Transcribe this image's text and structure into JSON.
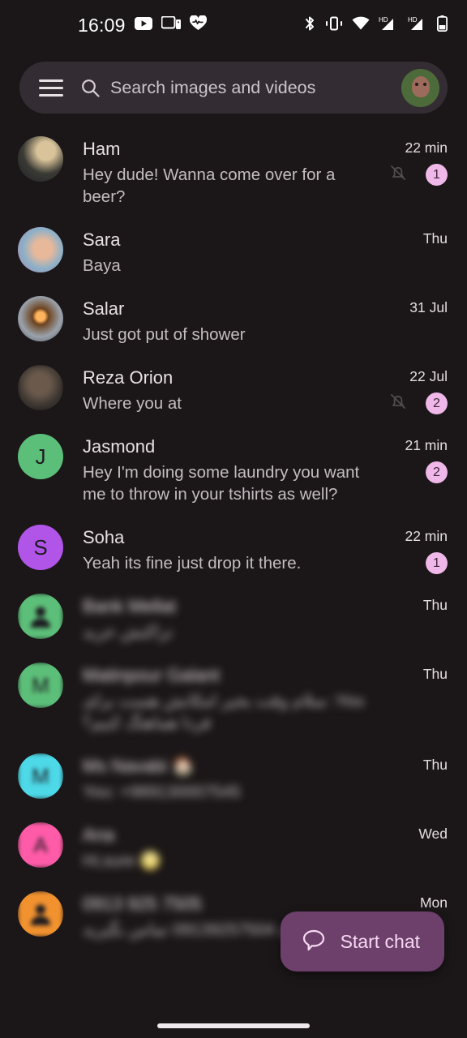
{
  "statusbar": {
    "time": "16:09",
    "left_icons": [
      "youtube-icon",
      "cast-icon",
      "heart-health-icon"
    ],
    "right_icons": [
      "bluetooth-icon",
      "vibrate-icon",
      "wifi-icon",
      "signal-hd-1-icon",
      "signal-hd-2-icon",
      "battery-icon"
    ]
  },
  "search": {
    "placeholder": "Search images and videos",
    "menu_icon": "hamburger-menu-icon",
    "search_icon": "search-icon",
    "avatar": "monkey-profile-avatar"
  },
  "colors": {
    "background": "#1b1718",
    "searchbar": "#332d33",
    "badge": "#efb8e8",
    "fab": "#6d3f6b",
    "fab_text": "#f6d9f2",
    "avatar_green": "#5cbf79",
    "avatar_purple": "#b055e8",
    "avatar_cyan": "#4dd9e8",
    "avatar_pink": "#ff5ba8",
    "avatar_orange": "#f2922f"
  },
  "fab": {
    "label": "Start chat",
    "icon": "chat-bubble-icon"
  },
  "conversations": [
    {
      "name": "Ham",
      "preview": "Hey dude! Wanna come over for a beer?",
      "time": "22 min",
      "badge": "1",
      "muted": true,
      "avatar_type": "photo",
      "avatar_kind": "ham-photo",
      "blurred": false
    },
    {
      "name": "Sara",
      "preview": "Baya",
      "time": "Thu",
      "badge": "",
      "muted": false,
      "avatar_type": "photo",
      "avatar_kind": "sara-photo",
      "blurred": false
    },
    {
      "name": "Salar",
      "preview": "Just got put of shower",
      "time": "31 Jul",
      "badge": "",
      "muted": false,
      "avatar_type": "photo",
      "avatar_kind": "salar-photo",
      "blurred": false
    },
    {
      "name": "Reza Orion",
      "preview": "Where you at",
      "time": "22 Jul",
      "badge": "2",
      "muted": true,
      "avatar_type": "photo",
      "avatar_kind": "reza-photo",
      "blurred": false
    },
    {
      "name": "Jasmond",
      "preview": "Hey I'm doing some laundry you want me to throw in your tshirts as well?",
      "time": "21 min",
      "badge": "2",
      "muted": false,
      "avatar_type": "letter",
      "avatar_letter": "J",
      "avatar_color": "#5cbf79",
      "blurred": false
    },
    {
      "name": "Soha",
      "preview": "Yeah its fine just drop it there.",
      "time": "22 min",
      "badge": "1",
      "muted": false,
      "avatar_type": "letter",
      "avatar_letter": "S",
      "avatar_color": "#b055e8",
      "blurred": false
    },
    {
      "name": "Bank Mellat",
      "preview": "تراکنش خرید",
      "time": "Thu",
      "badge": "",
      "muted": false,
      "avatar_type": "person",
      "avatar_color": "#5cbf79",
      "blurred": true
    },
    {
      "name": "Matinpour Galant",
      "preview": "You: سلام وقت بخیر امکانش هست برای فردا هماهنگ کنیم؟",
      "time": "Thu",
      "badge": "",
      "muted": false,
      "avatar_type": "letter",
      "avatar_letter": "M",
      "avatar_color": "#5cbf79",
      "blurred": true
    },
    {
      "name": "Ms Navabi 🏠",
      "preview": "You: +989130007545",
      "time": "Thu",
      "badge": "",
      "muted": false,
      "avatar_type": "letter",
      "avatar_letter": "M",
      "avatar_color": "#4dd9e8",
      "blurred": true
    },
    {
      "name": "Ana",
      "preview": "Hi,sure 🌝",
      "time": "Wed",
      "badge": "",
      "muted": false,
      "avatar_type": "letter",
      "avatar_letter": "A",
      "avatar_color": "#ff5ba8",
      "blurred": true
    },
    {
      "name": "0913 925 7505",
      "preview": "با شماره 09139257504 تماس بگیرید",
      "time": "Mon",
      "badge": "",
      "muted": false,
      "avatar_type": "person",
      "avatar_color": "#f2922f",
      "blurred": true
    }
  ]
}
